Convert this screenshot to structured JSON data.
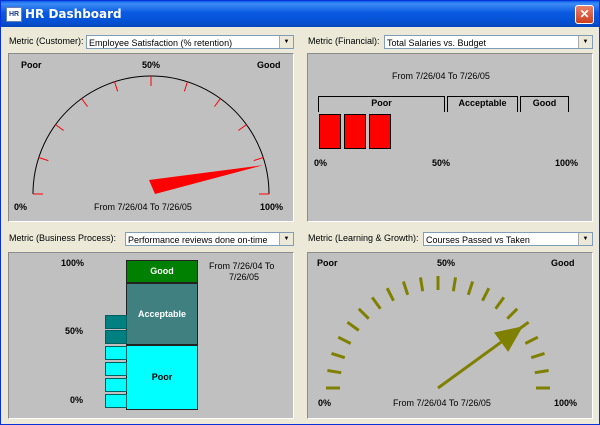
{
  "window": {
    "title": "HR Dashboard",
    "icon": "app-icon-hr",
    "close_icon": "close-icon"
  },
  "customer": {
    "metric_label": "Metric (Customer):",
    "select_value": "Employee Satisfaction (% retention)",
    "gauge": {
      "poor": "Poor",
      "mid": "50%",
      "good": "Good",
      "min": "0%",
      "max": "100%",
      "value_percent": 92,
      "needle_color": "#ff0000"
    },
    "date_range": "From 7/26/04 To 7/26/05"
  },
  "financial": {
    "metric_label": "Metric (Financial):",
    "select_value": "Total Salaries vs. Budget",
    "date_range": "From 7/26/04 To 7/26/05",
    "bands": {
      "poor": "Poor",
      "acceptable": "Acceptable",
      "good": "Good"
    },
    "axis": {
      "min": "0%",
      "mid": "50%",
      "max": "100%"
    },
    "bar_count": 3,
    "bar_color": "#ff0000"
  },
  "business": {
    "metric_label": "Metric (Business Process):",
    "select_value": "Performance reviews done on-time",
    "date_range_line1": "From 7/26/04 To",
    "date_range_line2": "7/26/05",
    "axis": {
      "top": "100%",
      "mid": "50%",
      "bottom": "0%"
    },
    "segments": {
      "good": "Good",
      "acceptable": "Acceptable",
      "poor": "Poor"
    },
    "colors": {
      "good": "#008000",
      "acceptable": "#408080",
      "poor": "#00ffff"
    }
  },
  "learning": {
    "metric_label": "Metric (Learning & Growth):",
    "select_value": "Courses Passed vs Taken",
    "gauge": {
      "poor": "Poor",
      "mid": "50%",
      "good": "Good",
      "min": "0%",
      "max": "100%",
      "value_percent": 80,
      "needle_color": "#808000"
    },
    "date_range": "From 7/26/04 To 7/26/05"
  }
}
